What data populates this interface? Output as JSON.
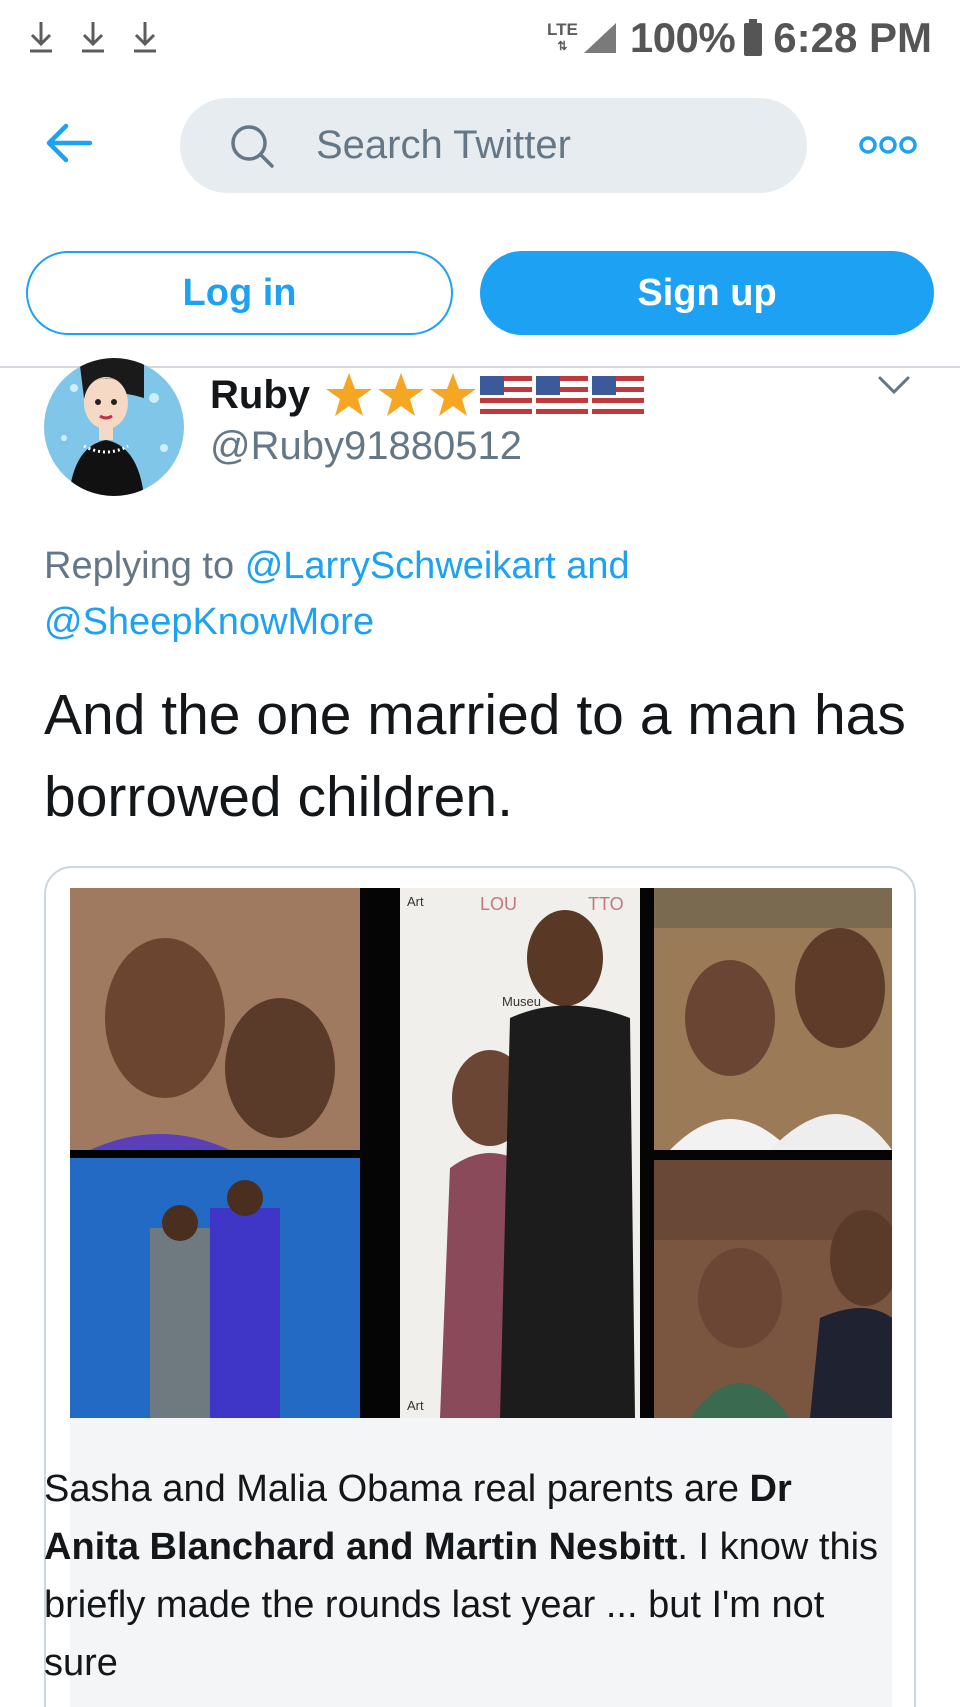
{
  "status_bar": {
    "network": "LTE",
    "battery": "100%",
    "time": "6:28 PM",
    "icons": [
      "download-icon",
      "download-icon",
      "download-icon",
      "signal-icon",
      "battery-icon"
    ]
  },
  "header": {
    "back_icon": "back-arrow-icon",
    "search_placeholder": "Search Twitter",
    "more_icon": "more-icon"
  },
  "auth": {
    "login_label": "Log in",
    "signup_label": "Sign up"
  },
  "tweet": {
    "display_name": "Ruby",
    "badges": [
      "star-icon",
      "star-icon",
      "star-icon",
      "us-flag-icon",
      "us-flag-icon",
      "us-flag-icon"
    ],
    "handle": "@Ruby91880512",
    "reply_prefix": "Replying to",
    "reply_mention_1": "@LarrySchweikart",
    "reply_conj": "and",
    "reply_mention_2": "@SheepKnowMore",
    "text": "And the one married to a man has borrowed children.",
    "media": {
      "caption_part1": "Sasha and Malia Obama real parents are ",
      "caption_bold1": "Dr Anita Blanchard and Martin Nesbitt",
      "caption_part2": ". I know this briefly made the rounds last year ... but I'm not sure",
      "photo_signage": [
        "Art",
        "LOU",
        "TTO",
        "Museu",
        "Art"
      ]
    }
  },
  "colors": {
    "accent": "#1da1f2",
    "secondary_text": "#657786",
    "search_bg": "#e6ecf0",
    "star": "#f5a623"
  }
}
